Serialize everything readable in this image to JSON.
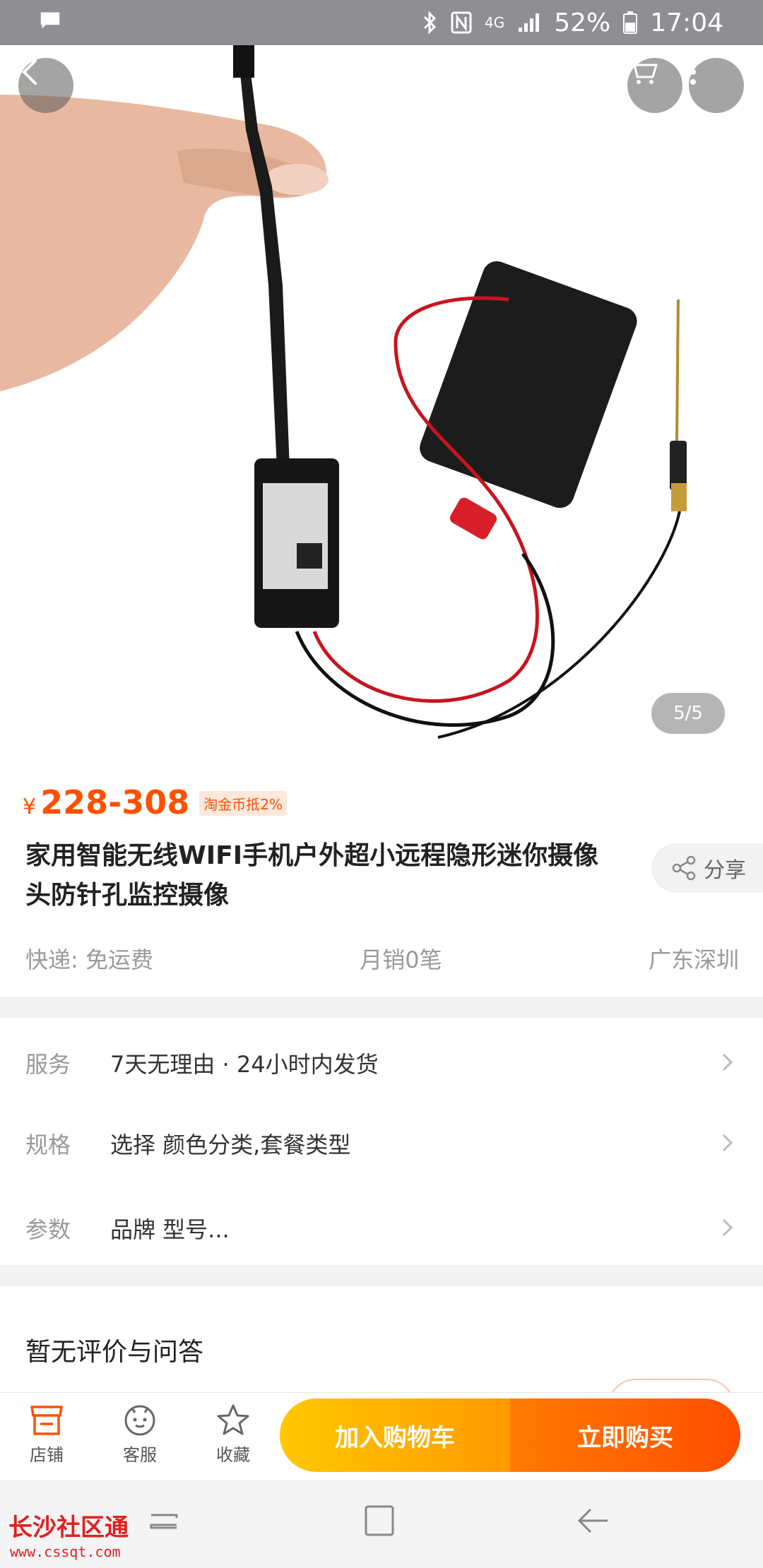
{
  "status_bar": {
    "battery": "52%",
    "time": "17:04",
    "network": "4G"
  },
  "gallery": {
    "pager": "5/5"
  },
  "product": {
    "currency": "¥",
    "price": "228-308",
    "coin_tag": "淘金币抵2%",
    "title": "家用智能无线WIFI手机户外超小远程隐形迷你摄像头防针孔监控摄像",
    "share_label": "分享",
    "shipping": "快递: 免运费",
    "monthly_sales": "月销0笔",
    "location": "广东深圳"
  },
  "options": [
    {
      "label": "服务",
      "value": "7天无理由 · 24小时内发货"
    },
    {
      "label": "规格",
      "value": "选择 颜色分类,套餐类型"
    },
    {
      "label": "参数",
      "value": "品牌 型号..."
    }
  ],
  "reviews": {
    "title": "暂无评价与问答"
  },
  "bottom_bar": {
    "shop": "店铺",
    "service": "客服",
    "favorite": "收藏",
    "add_to_cart": "加入购物车",
    "buy_now": "立即购买"
  },
  "watermark": {
    "text": "长沙社区通",
    "url": "www.cssqt.com"
  },
  "colors": {
    "accent": "#ff5000",
    "cart_button": "#ffb000",
    "buy_button": "#ff5a00"
  }
}
